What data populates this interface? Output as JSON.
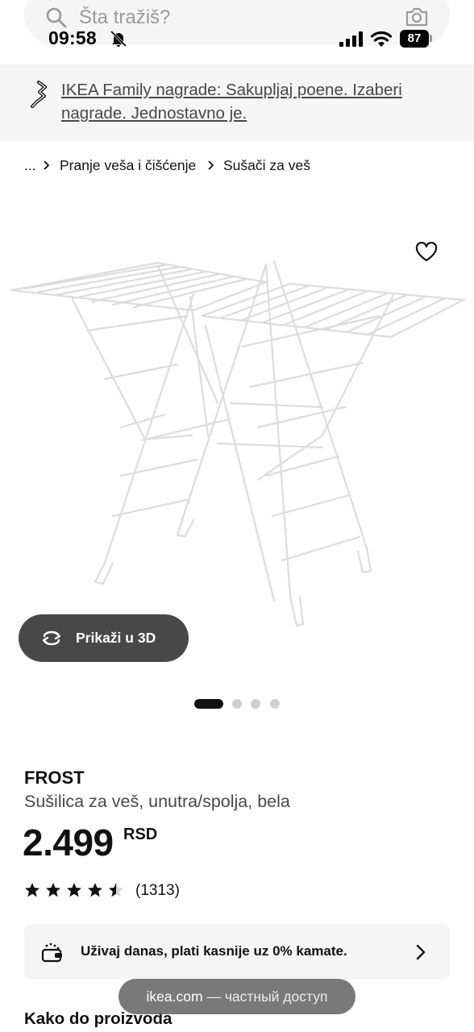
{
  "search": {
    "placeholder": "Šta tražiš?"
  },
  "status_bar": {
    "time": "09:58",
    "battery": "87"
  },
  "promo": {
    "text": "IKEA Family nagrade: Sakupljaj poene. Izaberi nagrade. Jednostavno je."
  },
  "breadcrumb": {
    "ellipsis": "...",
    "items": [
      "Pranje veša i čišćenje",
      "Sušači za veš"
    ]
  },
  "media": {
    "view_3d_label": "Prikaži u 3D",
    "slide_count": 4,
    "active_slide": 1
  },
  "product": {
    "name": "FROST",
    "description": "Sušilica za veš, unutra/spolja, bela",
    "price": "2.499",
    "currency": "RSD",
    "rating": 4.5,
    "review_count": "(1313)"
  },
  "payment": {
    "text": "Uživaj danas, plati kasnije uz 0% kamate."
  },
  "section": {
    "heading": "Kako do proizvoda"
  },
  "browser_toast": {
    "domain": "ikea.com",
    "note": "— частный доступ"
  },
  "icons": [
    "search-icon",
    "camera-icon",
    "bell-slash-icon",
    "signal-icon",
    "wifi-icon",
    "promo-icon",
    "chevron-right-icon",
    "heart-icon",
    "rotate-3d-icon",
    "star-icon",
    "payment-icon"
  ]
}
